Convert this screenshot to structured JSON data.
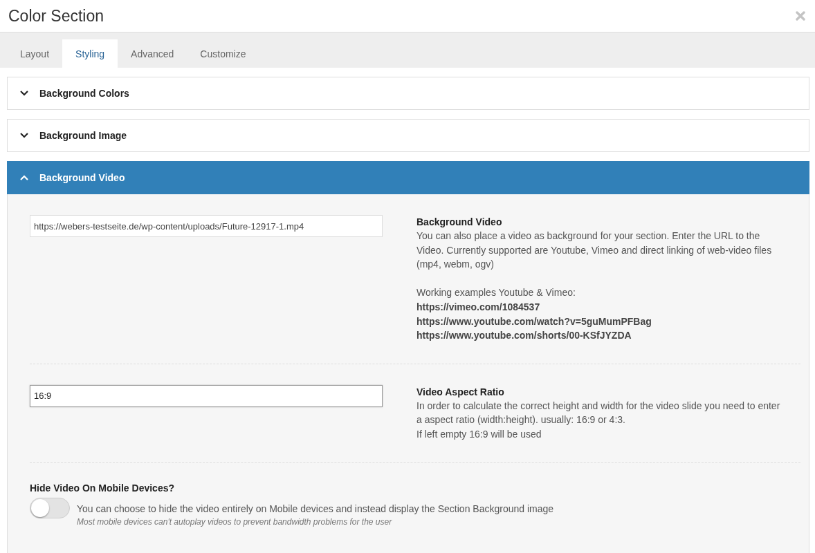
{
  "window": {
    "title": "Color Section"
  },
  "tabs": [
    {
      "label": "Layout",
      "selected": false
    },
    {
      "label": "Styling",
      "selected": true
    },
    {
      "label": "Advanced",
      "selected": false
    },
    {
      "label": "Customize",
      "selected": false
    }
  ],
  "panels": [
    {
      "title": "Background Colors",
      "expanded": false
    },
    {
      "title": "Background Image",
      "expanded": false
    },
    {
      "title": "Background Video",
      "expanded": true,
      "settings": [
        {
          "kind": "text",
          "value": "https://webers-testseite.de/wp-content/uploads/Future-12917-1.mp4",
          "focused": false,
          "label": "Background Video",
          "description": [
            "You can also place a video as background for your section. Enter the URL to the Video. Currently supported are Youtube, Vimeo and direct linking of web-video files (mp4, webm, ogv)"
          ],
          "examples_heading": "Working examples Youtube & Vimeo:",
          "examples": [
            "https://vimeo.com/1084537",
            "https://www.youtube.com/watch?v=5guMumPFBag",
            "https://www.youtube.com/shorts/00-KSfJYZDA"
          ]
        },
        {
          "kind": "text",
          "value": "16:9",
          "focused": true,
          "label": "Video Aspect Ratio",
          "description": [
            "In order to calculate the correct height and width for the video slide you need to enter a aspect ratio (width:height). usually: 16:9 or 4:3.",
            "If left empty 16:9 will be used"
          ]
        },
        {
          "kind": "toggle",
          "label": "Hide Video On Mobile Devices?",
          "on": false,
          "description": "You can choose to hide the video entirely on Mobile devices and instead display the Section Background image",
          "note": "Most mobile devices can't autoplay videos to prevent bandwidth problems for the user"
        }
      ]
    }
  ]
}
